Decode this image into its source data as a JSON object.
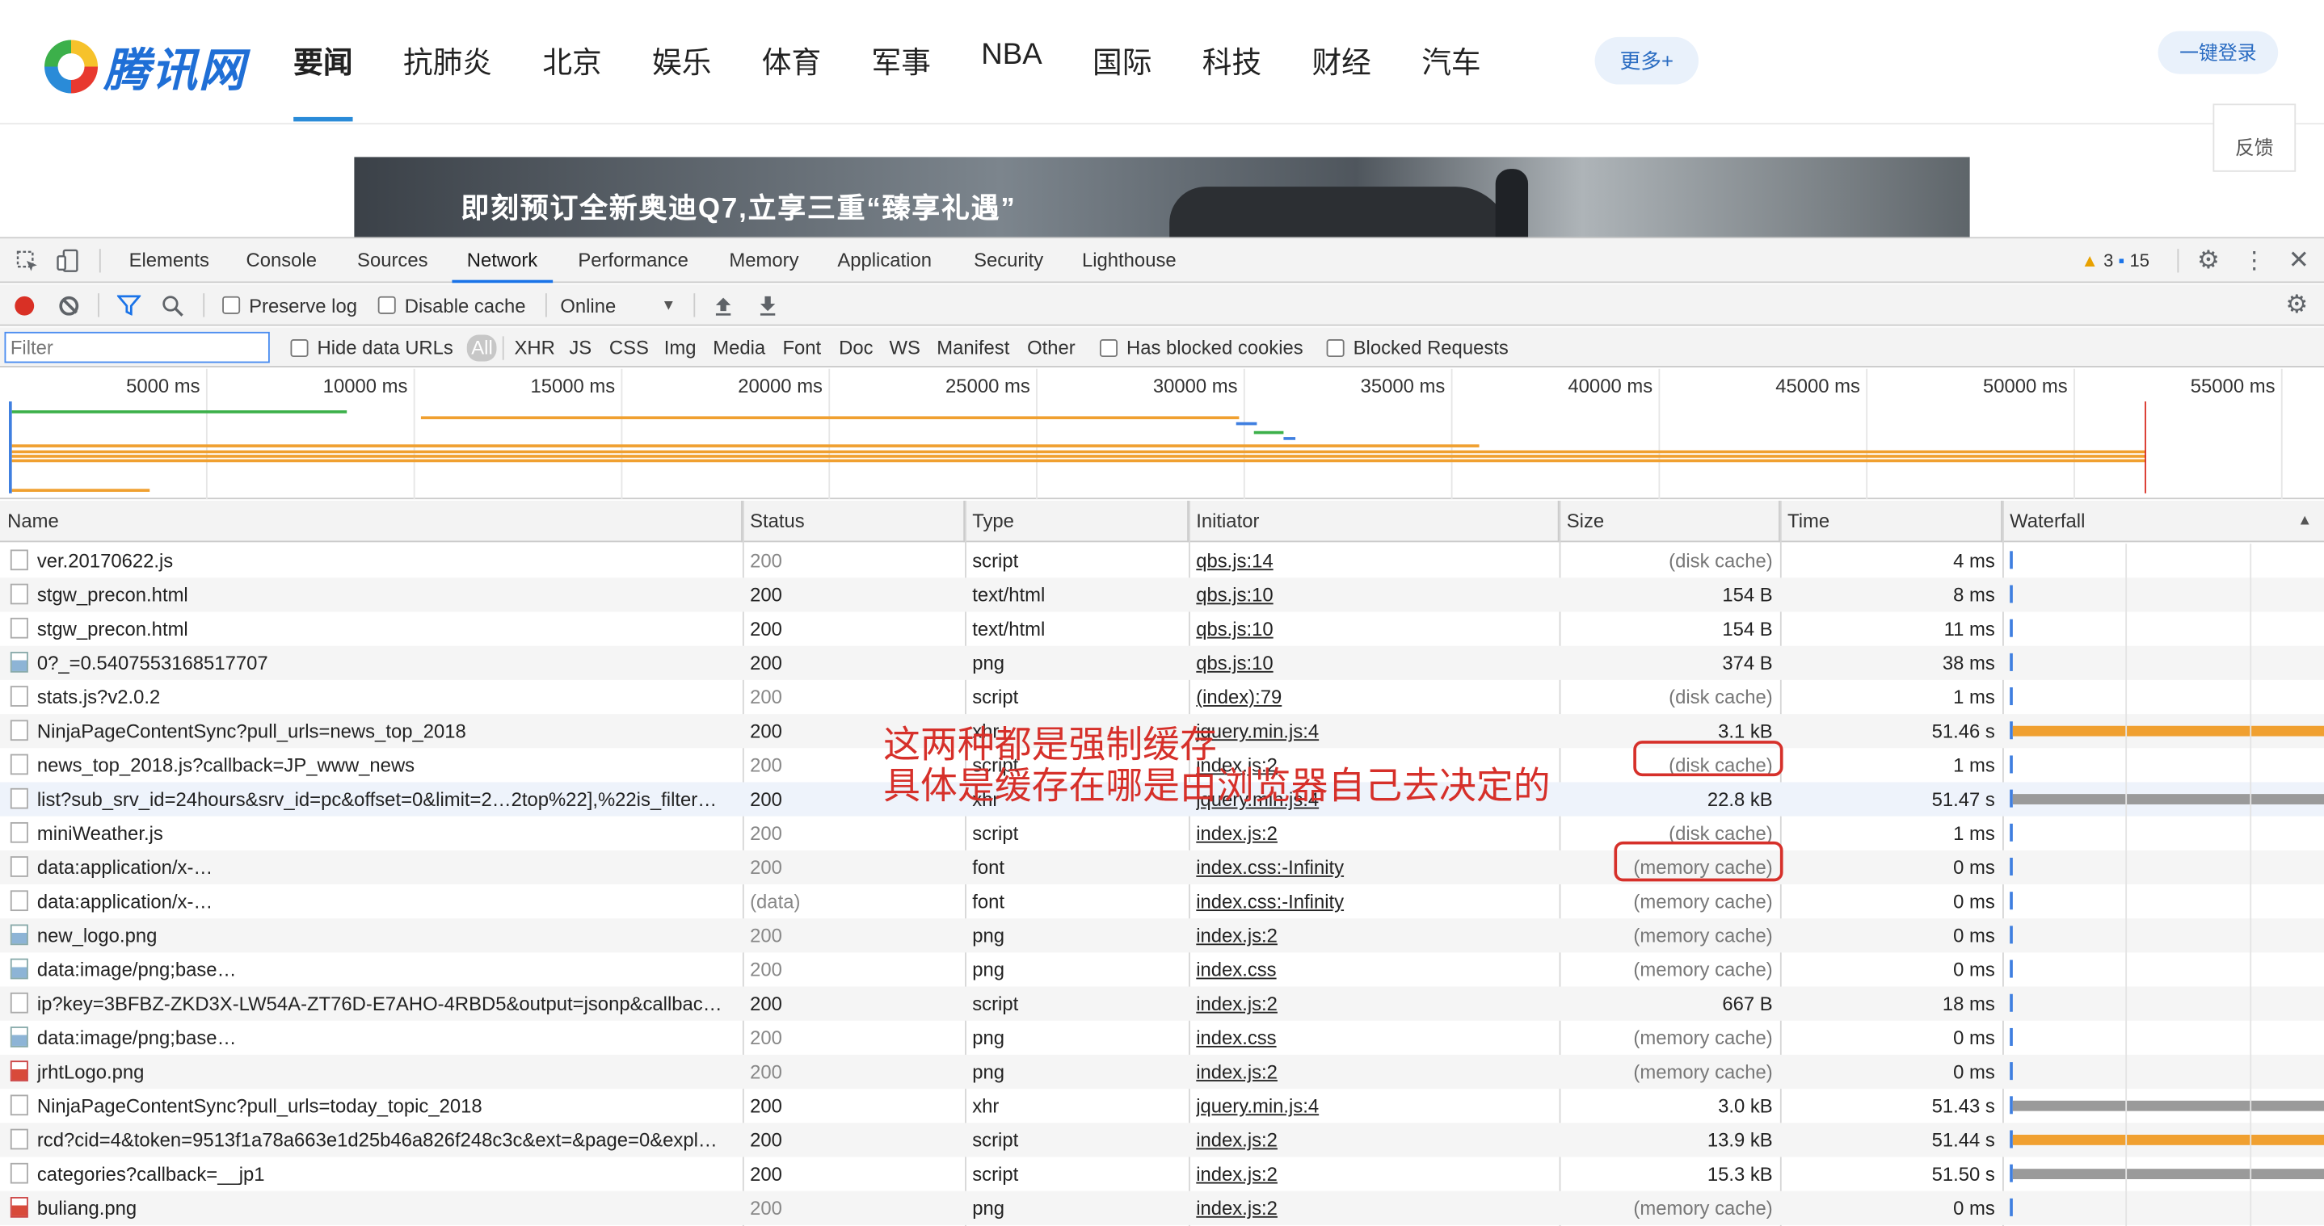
{
  "site": {
    "logo_text": "腾讯网",
    "nav": [
      "要闻",
      "抗肺炎",
      "北京",
      "娱乐",
      "体育",
      "军事",
      "NBA",
      "国际",
      "科技",
      "财经",
      "汽车"
    ],
    "more_label": "更多+",
    "login_label": "一键登录",
    "feedback_label": "反馈",
    "banner_text": "即刻预订全新奥迪Q7,立享三重“臻享礼遇”"
  },
  "devtools": {
    "tabs": [
      "Elements",
      "Console",
      "Sources",
      "Network",
      "Performance",
      "Memory",
      "Application",
      "Security",
      "Lighthouse"
    ],
    "active_tab": "Network",
    "warnings_count": "3",
    "messages_count": "15",
    "toolbar": {
      "preserve_log": "Preserve log",
      "disable_cache": "Disable cache",
      "throttling": "Online"
    },
    "filter": {
      "placeholder": "Filter",
      "hide_data_urls": "Hide data URLs",
      "types": [
        "All",
        "XHR",
        "JS",
        "CSS",
        "Img",
        "Media",
        "Font",
        "Doc",
        "WS",
        "Manifest",
        "Other"
      ],
      "has_blocked_cookies": "Has blocked cookies",
      "blocked_requests": "Blocked Requests"
    },
    "overview_ticks": [
      "5000 ms",
      "10000 ms",
      "15000 ms",
      "20000 ms",
      "25000 ms",
      "30000 ms",
      "35000 ms",
      "40000 ms",
      "45000 ms",
      "50000 ms",
      "55000 ms"
    ],
    "columns": [
      "Name",
      "Status",
      "Type",
      "Initiator",
      "Size",
      "Time",
      "Waterfall"
    ],
    "rows": [
      {
        "name": "ver.20170622.js",
        "status": "200",
        "type": "script",
        "initiator": "qbs.js:14",
        "size": "(disk cache)",
        "time": "4 ms"
      },
      {
        "name": "stgw_precon.html",
        "status": "200",
        "type": "text/html",
        "initiator": "qbs.js:10",
        "size": "154 B",
        "time": "8 ms"
      },
      {
        "name": "stgw_precon.html",
        "status": "200",
        "type": "text/html",
        "initiator": "qbs.js:10",
        "size": "154 B",
        "time": "11 ms"
      },
      {
        "name": "0?_=0.5407553168517707",
        "status": "200",
        "type": "png",
        "initiator": "qbs.js:10",
        "size": "374 B",
        "time": "38 ms"
      },
      {
        "name": "stats.js?v2.0.2",
        "status": "200",
        "type": "script",
        "initiator": "(index):79",
        "size": "(disk cache)",
        "time": "1 ms"
      },
      {
        "name": "NinjaPageContentSync?pull_urls=news_top_2018",
        "status": "200",
        "type": "xhr",
        "initiator": "jquery.min.js:4",
        "size": "3.1 kB",
        "time": "51.46 s"
      },
      {
        "name": "news_top_2018.js?callback=JP_www_news",
        "status": "200",
        "type": "script",
        "initiator": "index.js:2",
        "size": "(disk cache)",
        "time": "1 ms"
      },
      {
        "name": "list?sub_srv_id=24hours&srv_id=pc&offset=0&limit=2…2top%22],%22is_filter…",
        "status": "200",
        "type": "xhr",
        "initiator": "jquery.min.js:4",
        "size": "22.8 kB",
        "time": "51.47 s"
      },
      {
        "name": "miniWeather.js",
        "status": "200",
        "type": "script",
        "initiator": "index.js:2",
        "size": "(disk cache)",
        "time": "1 ms"
      },
      {
        "name": "data:application/x-…",
        "status": "200",
        "type": "font",
        "initiator": "index.css:-Infinity",
        "size": "(memory cache)",
        "time": "0 ms"
      },
      {
        "name": "data:application/x-…",
        "status": "(data)",
        "type": "font",
        "initiator": "index.css:-Infinity",
        "size": "(memory cache)",
        "time": "0 ms"
      },
      {
        "name": "new_logo.png",
        "status": "200",
        "type": "png",
        "initiator": "index.js:2",
        "size": "(memory cache)",
        "time": "0 ms"
      },
      {
        "name": "data:image/png;base…",
        "status": "200",
        "type": "png",
        "initiator": "index.css",
        "size": "(memory cache)",
        "time": "0 ms"
      },
      {
        "name": "ip?key=3BFBZ-ZKD3X-LW54A-ZT76D-E7AHO-4RBD5&output=jsonp&callbac…",
        "status": "200",
        "type": "script",
        "initiator": "index.js:2",
        "size": "667 B",
        "time": "18 ms"
      },
      {
        "name": "data:image/png;base…",
        "status": "200",
        "type": "png",
        "initiator": "index.css",
        "size": "(memory cache)",
        "time": "0 ms"
      },
      {
        "name": "jrhtLogo.png",
        "status": "200",
        "type": "png",
        "initiator": "index.js:2",
        "size": "(memory cache)",
        "time": "0 ms"
      },
      {
        "name": "NinjaPageContentSync?pull_urls=today_topic_2018",
        "status": "200",
        "type": "xhr",
        "initiator": "jquery.min.js:4",
        "size": "3.0 kB",
        "time": "51.43 s"
      },
      {
        "name": "rcd?cid=4&token=9513f1a78a663e1d25b46a826f248c3c&ext=&page=0&expl…",
        "status": "200",
        "type": "script",
        "initiator": "index.js:2",
        "size": "13.9 kB",
        "time": "51.44 s"
      },
      {
        "name": "categories?callback=__jp1",
        "status": "200",
        "type": "script",
        "initiator": "index.js:2",
        "size": "15.3 kB",
        "time": "51.50 s"
      },
      {
        "name": "buliang.png",
        "status": "200",
        "type": "png",
        "initiator": "index.js:2",
        "size": "(memory cache)",
        "time": "0 ms"
      }
    ]
  },
  "annotation": {
    "line1": "这两种都是强制缓存",
    "line2": "具体是缓存在哪是由浏览器自己去决定的"
  }
}
